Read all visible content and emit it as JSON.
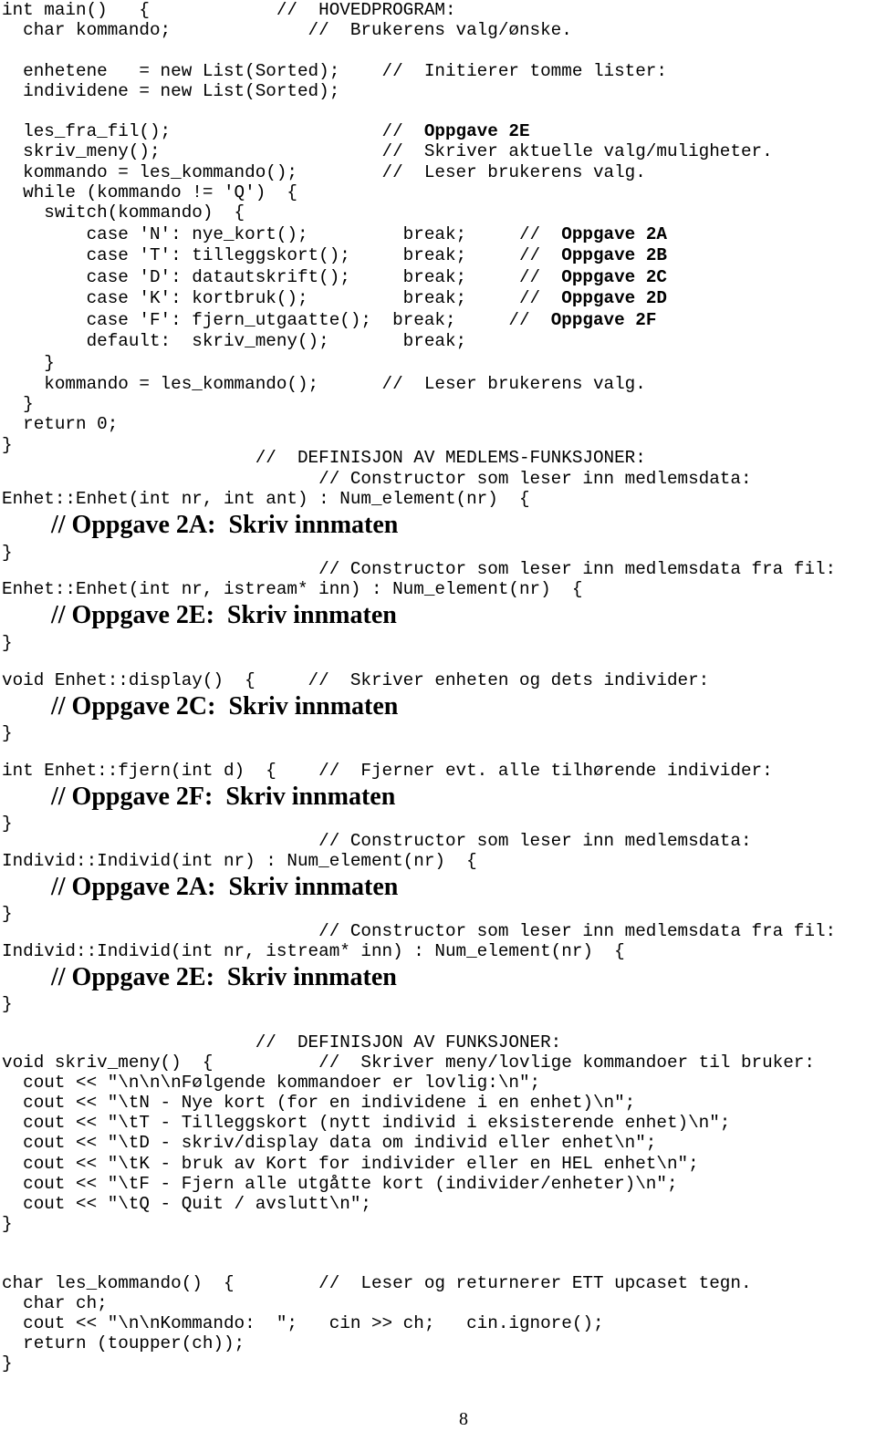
{
  "page_number": "8",
  "code": {
    "main": [
      "int main()   {            //  HOVEDPROGRAM:",
      "  char kommando;             //  Brukerens valg/ønske.",
      "",
      "  enhetene   = new List(Sorted);    //  Initierer tomme lister:",
      "  individene = new List(Sorted);",
      "",
      "  les_fra_fil();                    //  ",
      "  skriv_meny();                     //  Skriver aktuelle valg/muligheter.",
      "  kommando = les_kommando();        //  Leser brukerens valg.",
      "  while (kommando != 'Q')  {",
      "    switch(kommando)  {",
      "        case 'N': nye_kort();         break;     //  ",
      "        case 'T': tilleggskort();     break;     //  ",
      "        case 'D': datautskrift();     break;     //  ",
      "        case 'K': kortbruk();         break;     //  ",
      "        case 'F': fjern_utgaatte();  break;     //  ",
      "        default:  skriv_meny();       break;",
      "    }",
      "    kommando = les_kommando();      //  Leser brukerens valg.",
      "  }",
      "  return 0;",
      "}"
    ],
    "main_bold": {
      "les_fra_fil": "Oppgave 2E",
      "case_N": "Oppgave 2A",
      "case_T": "Oppgave 2B",
      "case_D": "Oppgave 2C",
      "case_K": "Oppgave 2D",
      "case_F": "Oppgave 2F"
    },
    "member_header": "                        //  DEFINISJON AV MEDLEMS-FUNKSJONER:",
    "enhet_ctor_comment": "                              // Constructor som leser inn medlemsdata:",
    "enhet_ctor_sig": "Enhet::Enhet(int nr, int ant) : Num_element(nr)  {",
    "task_2a_1": "// Oppgave 2A:  Skriv innmaten",
    "close": "}",
    "enhet_file_ctor_comment": "                              // Constructor som leser inn medlemsdata fra fil:",
    "enhet_file_ctor_sig": "Enhet::Enhet(int nr, istream* inn) : Num_element(nr)  {",
    "task_2e_1": "// Oppgave 2E:  Skriv innmaten",
    "display_sig": "void Enhet::display()  {     //  Skriver enheten og dets individer:",
    "task_2c": "// Oppgave 2C:  Skriv innmaten",
    "fjern_sig": "int Enhet::fjern(int d)  {    //  Fjerner evt. alle tilhørende individer:",
    "task_2f": "// Oppgave 2F:  Skriv innmaten",
    "individ_ctor_comment": "                              // Constructor som leser inn medlemsdata:",
    "individ_ctor_sig": "Individ::Individ(int nr) : Num_element(nr)  {",
    "task_2a_2": "// Oppgave 2A:  Skriv innmaten",
    "individ_file_ctor_comment": "                              // Constructor som leser inn medlemsdata fra fil:",
    "individ_file_ctor_sig": "Individ::Individ(int nr, istream* inn) : Num_element(nr)  {",
    "task_2e_2": "// Oppgave 2E:  Skriv innmaten",
    "func_header": "                        //  DEFINISJON AV FUNKSJONER:",
    "skriv_meny": [
      "void skriv_meny()  {          //  Skriver meny/lovlige kommandoer til bruker:",
      "  cout << \"\\n\\n\\nFølgende kommandoer er lovlig:\\n\";",
      "  cout << \"\\tN - Nye kort (for en individene i en enhet)\\n\";",
      "  cout << \"\\tT - Tilleggskort (nytt individ i eksisterende enhet)\\n\";",
      "  cout << \"\\tD - skriv/display data om individ eller enhet\\n\";",
      "  cout << \"\\tK - bruk av Kort for individer eller en HEL enhet\\n\";",
      "  cout << \"\\tF - Fjern alle utgåtte kort (individer/enheter)\\n\";",
      "  cout << \"\\tQ - Quit / avslutt\\n\";",
      "}"
    ],
    "les_kommando": [
      "char les_kommando()  {        //  Leser og returnerer ETT upcaset tegn.",
      "  char ch;",
      "  cout << \"\\n\\nKommando:  \";   cin >> ch;   cin.ignore();",
      "  return (toupper(ch));",
      "}"
    ]
  }
}
